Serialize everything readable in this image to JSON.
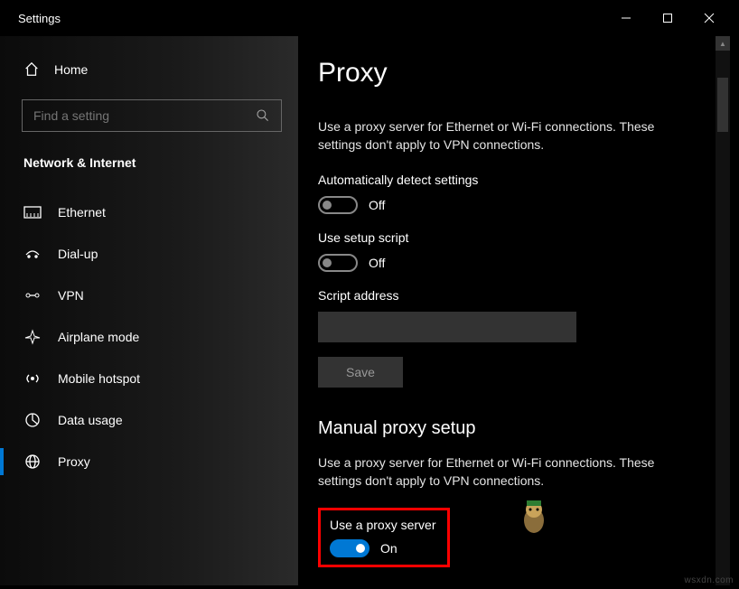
{
  "titlebar": {
    "title": "Settings"
  },
  "sidebar": {
    "home_label": "Home",
    "search_placeholder": "Find a setting",
    "section_label": "Network & Internet",
    "items": [
      {
        "label": "Ethernet"
      },
      {
        "label": "Dial-up"
      },
      {
        "label": "VPN"
      },
      {
        "label": "Airplane mode"
      },
      {
        "label": "Mobile hotspot"
      },
      {
        "label": "Data usage"
      },
      {
        "label": "Proxy"
      }
    ]
  },
  "content": {
    "heading": "Proxy",
    "auto": {
      "desc": "Use a proxy server for Ethernet or Wi-Fi connections. These settings don't apply to VPN connections.",
      "detect_label": "Automatically detect settings",
      "detect_state": "Off",
      "script_label": "Use setup script",
      "script_state": "Off",
      "address_label": "Script address",
      "save_label": "Save"
    },
    "manual": {
      "heading": "Manual proxy setup",
      "desc": "Use a proxy server for Ethernet or Wi-Fi connections. These settings don't apply to VPN connections.",
      "use_proxy_label": "Use a proxy server",
      "use_proxy_state": "On"
    }
  },
  "watermark": "wsxdn.com"
}
